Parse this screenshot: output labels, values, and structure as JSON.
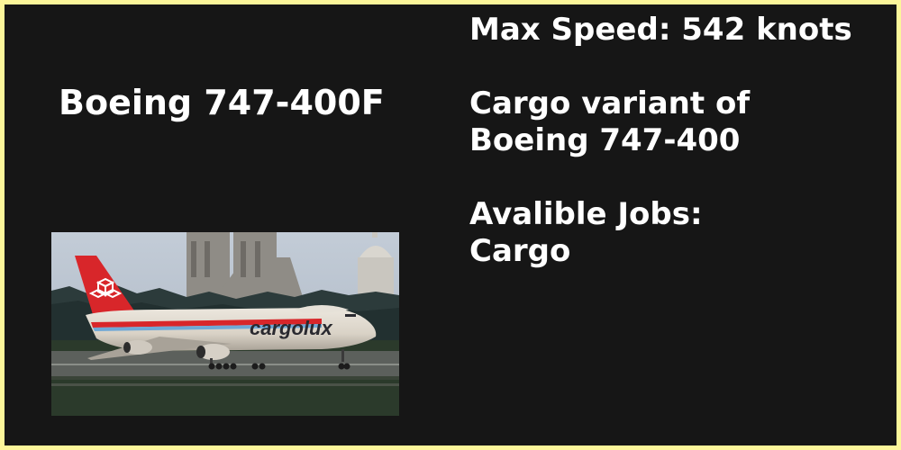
{
  "aircraft": {
    "name": "Boeing 747-400F",
    "speed_line": "Max Speed: 542 knots",
    "description_line1": "Cargo variant of",
    "description_line2": "Boeing 747-400",
    "jobs_heading": "Avalible Jobs:",
    "jobs_value": "Cargo"
  },
  "photo": {
    "icon": "cargo-aircraft-photo",
    "livery_text": "cargolux",
    "colors": {
      "sky": "#b9c3cf",
      "hills": "#2c3b3b",
      "grass": "#2b3a2b",
      "runway": "#5c605c",
      "fuselage": "#e2dcd2",
      "tail": "#d8262a",
      "stripe_red": "#d8262a",
      "stripe_blue": "#6fa8d6",
      "livery_text": "#2a2a30"
    }
  },
  "theme": {
    "background": "#161616",
    "border": "#fcf69a",
    "text": "#ffffff"
  }
}
